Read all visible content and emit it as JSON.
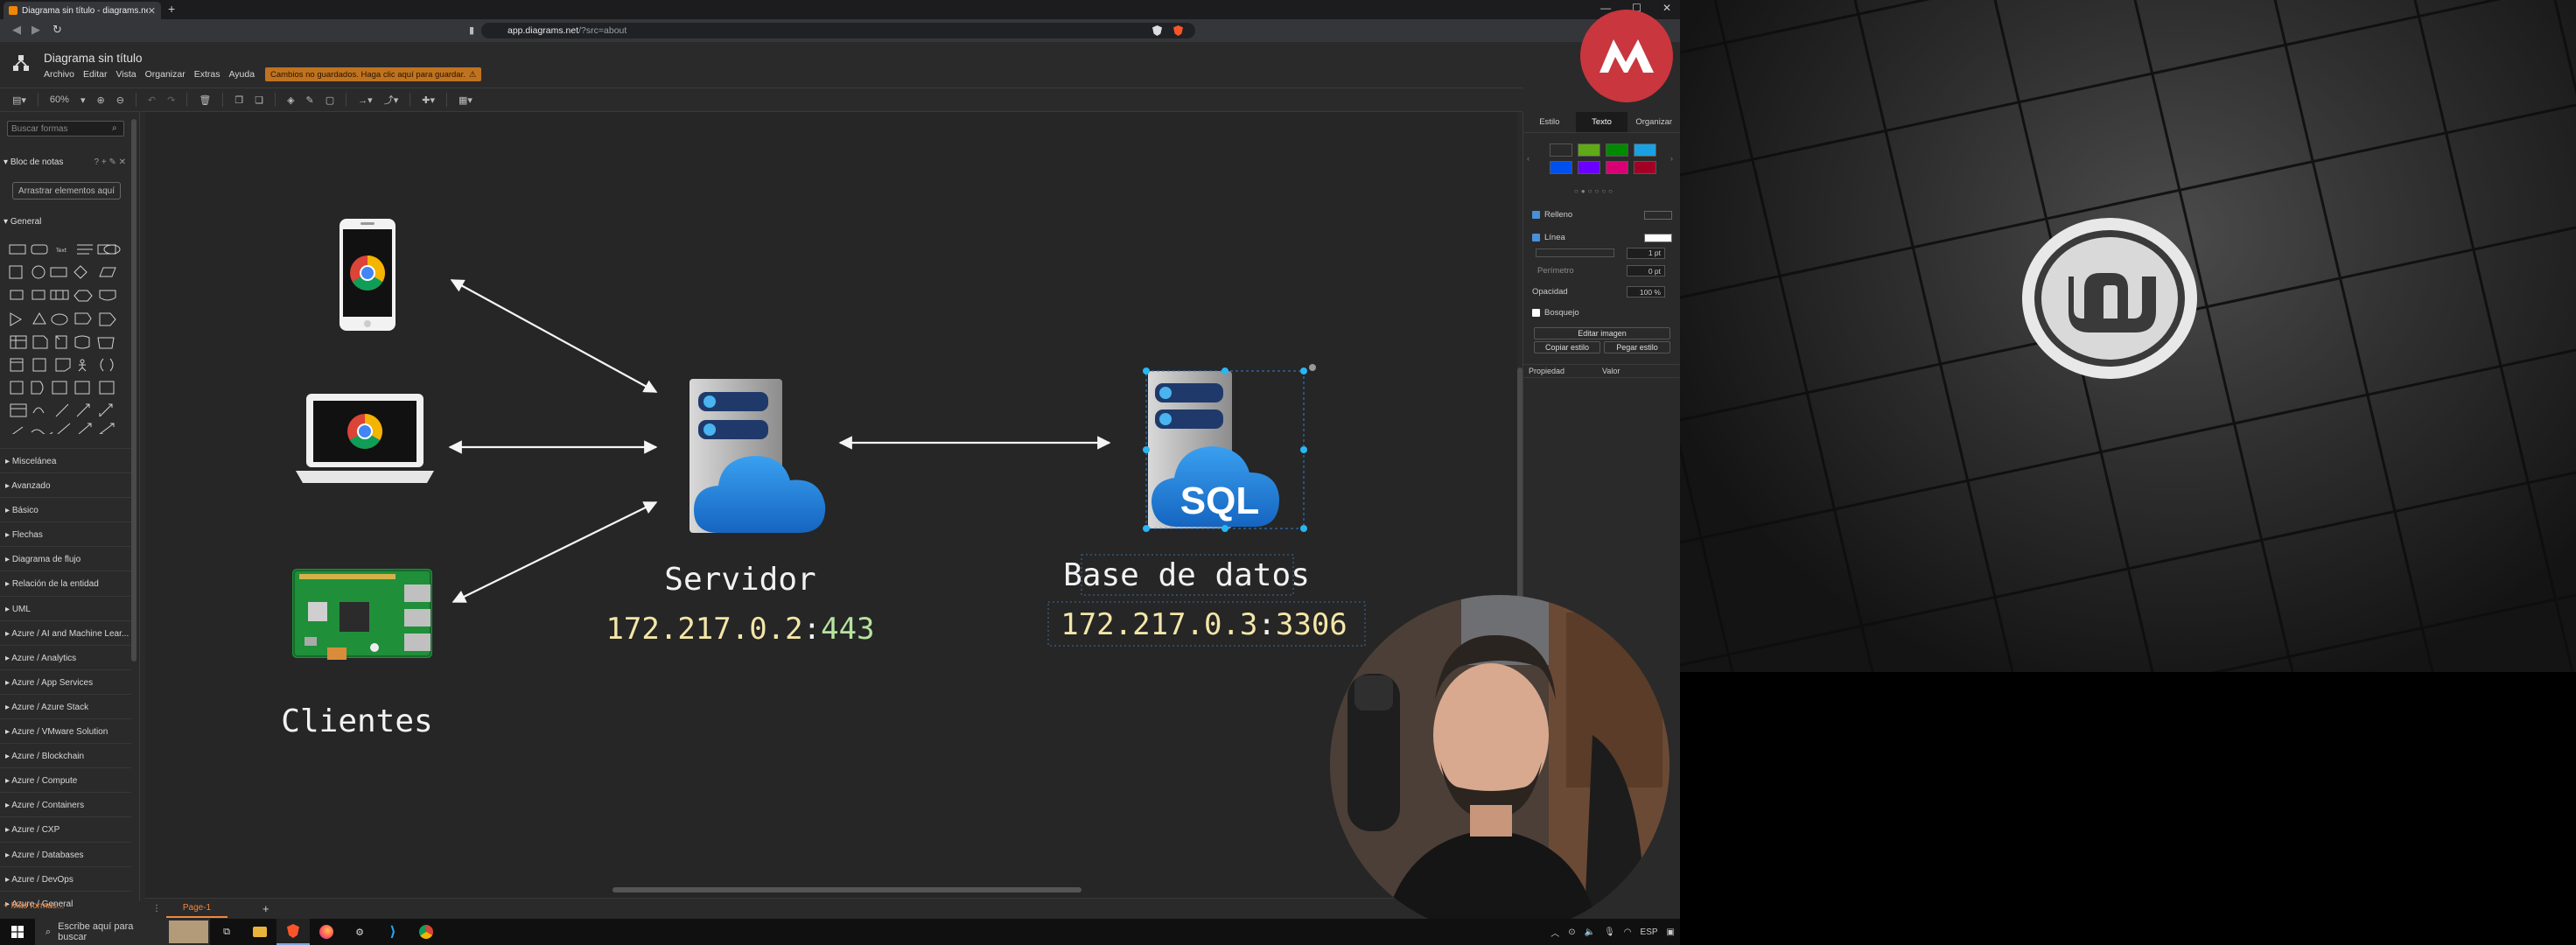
{
  "browser": {
    "tab_title": "Diagrama sin título - diagrams.ne",
    "tab_close": "✕",
    "new_tab": "+",
    "url_host": "app.diagrams.net",
    "url_path": "/?src=about",
    "win_min": "—",
    "win_max": "☐",
    "win_close": "✕"
  },
  "app": {
    "doc_title": "Diagrama sin título",
    "menu": [
      "Archivo",
      "Editar",
      "Vista",
      "Organizar",
      "Extras",
      "Ayuda"
    ],
    "unsaved_notice": "Cambios no guardados. Haga clic aquí para guardar.",
    "zoom": "60%"
  },
  "shapes_panel": {
    "search_placeholder": "Buscar formas",
    "scratchpad_label": "Bloc de notas",
    "scratchpad_tools": "? + ✎ ✕",
    "drag_here": "Arrastrar elementos aquí",
    "general_label": "General",
    "categories": [
      "Miscelánea",
      "Avanzado",
      "Básico",
      "Flechas",
      "Diagrama de flujo",
      "Relación de la entidad",
      "UML",
      "Azure / AI and Machine Lear...",
      "Azure / Analytics",
      "Azure / App Services",
      "Azure / Azure Stack",
      "Azure / VMware Solution",
      "Azure / Blockchain",
      "Azure / Compute",
      "Azure / Containers",
      "Azure / CXP",
      "Azure / Databases",
      "Azure / DevOps",
      "Azure / General"
    ],
    "more_shapes": "+ Más formas..."
  },
  "diagram": {
    "clients_label": "Clientes",
    "server_label": "Servidor",
    "server_ip": "172.217.0.2",
    "server_port": "443",
    "db_label": "Base de datos",
    "db_ip": "172.217.0.3",
    "db_port": "3306",
    "sql_text": "SQL"
  },
  "format_panel": {
    "tabs": [
      "Estilo",
      "Texto",
      "Organizar"
    ],
    "palette": [
      "#2a2a2a",
      "#60a917",
      "#008a00",
      "#1ba1e2",
      "#0050ef",
      "#6a00ff",
      "#d80073",
      "#a20025"
    ],
    "fill_label": "Relleno",
    "line_label": "Línea",
    "line_width": "1 pt",
    "perimeter_label": "Perímetro",
    "perimeter_value": "0 pt",
    "opacity_label": "Opacidad",
    "opacity_value": "100 %",
    "sketch_label": "Bosquejo",
    "edit_image": "Editar imagen",
    "copy_style": "Copiar estilo",
    "paste_style": "Pegar estilo",
    "property_col": "Propiedad",
    "value_col": "Valor"
  },
  "pages": {
    "tab": "Page-1",
    "add": "+",
    "menu": "⋮"
  },
  "taskbar": {
    "search_text": "Escribe aquí para buscar",
    "lang": "ESP"
  },
  "colors": {
    "accent_orange": "#f0883e",
    "ip_yellow": "#f3e6a8",
    "port_green": "#b5e3a0",
    "channel_red": "#c9363e"
  }
}
